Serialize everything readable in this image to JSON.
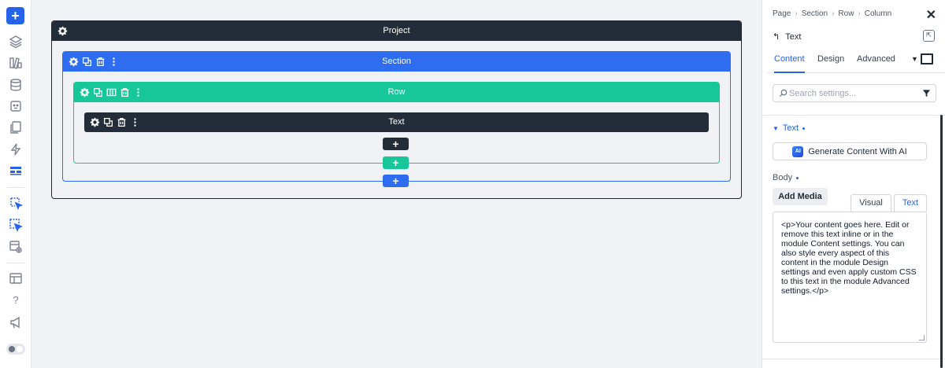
{
  "canvas": {
    "project_label": "Project",
    "section_label": "Section",
    "row_label": "Row",
    "module_label": "Text",
    "add_symbol": "+"
  },
  "leftbar": {
    "add_symbol": "+",
    "help_symbol": "?",
    "icons": [
      "plus-icon",
      "layers-icon",
      "library-icon",
      "database-icon",
      "ai-face-icon",
      "pages-icon",
      "bolt-icon",
      "layout-icon",
      "select-element-icon",
      "select-cursor-icon",
      "settings-layout-icon",
      "window-icon",
      "help-icon",
      "megaphone-icon",
      "theme-toggle"
    ]
  },
  "panel": {
    "breadcrumb": [
      "Page",
      "Section",
      "Row",
      "Column"
    ],
    "breadcrumb_sep": "›",
    "close_symbol": "✕",
    "back_symbol": "↰",
    "module_title": "Text",
    "tabs": [
      "Content",
      "Design",
      "Advanced"
    ],
    "active_tab": "Content",
    "caret_symbol": "▼",
    "search_placeholder": "Search settings...",
    "group_title": "Text",
    "group_caret": "▼",
    "ai_badge": "AI",
    "ai_button": "Generate Content With AI",
    "body_label": "Body",
    "add_media": "Add Media",
    "editor_tabs": [
      "Visual",
      "Text"
    ],
    "active_editor_tab": "Text",
    "editor_content": "<p>Your content goes here. Edit or remove this text inline or in the module Content settings. You can also style every aspect of this content in the module Design settings and even apply custom CSS to this text in the module Advanced settings.</p>"
  },
  "colors": {
    "project": "#232d39",
    "section": "#2f6df0",
    "row": "#17c79a",
    "module": "#232d39",
    "accent": "#2563eb"
  }
}
